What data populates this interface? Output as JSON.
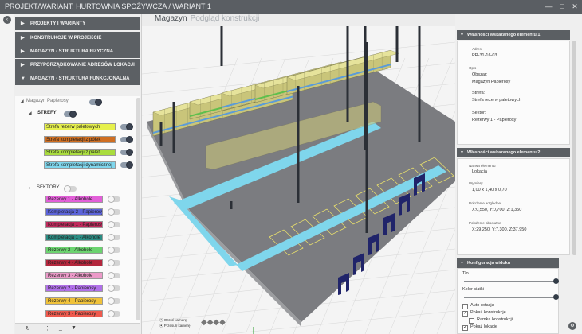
{
  "titlebar": {
    "title": "PROJEKT/WARIANT: HURTOWNIA SPOŻYWCZA / WARIANT 1"
  },
  "left": {
    "sections": [
      {
        "label": "Projekty i warianty"
      },
      {
        "label": "Konstrukcje w projekcie"
      },
      {
        "label": "Magazyn - struktura fizyczna"
      },
      {
        "label": "Przyporządkowanie adresów lokacji"
      },
      {
        "label": "Magazyn - struktura funkcjonalna"
      }
    ],
    "tree": {
      "root": "Magazyn Papierosy",
      "strefy_label": "STREFY",
      "strefy": [
        {
          "label": "Strefa rezerw paletowych",
          "color": "#e6f04c",
          "on": true
        },
        {
          "label": "Strefa kompletacji z półek",
          "color": "#cf6e22",
          "on": true
        },
        {
          "label": "Strefa kompletacji z palet",
          "color": "#a9dc3e",
          "on": true
        },
        {
          "label": "Strefa kompletacji dynamicznej",
          "color": "#7fd6ec",
          "on": true
        }
      ],
      "sektory_label": "SEKTORY",
      "sektory": [
        {
          "label": "Rezerwy 1 - Alkohole",
          "color": "#e25fd8",
          "on": false
        },
        {
          "label": "Kompletacja 2 - Papierosy",
          "color": "#5b63d9",
          "on": false
        },
        {
          "label": "Kompletacja 1 - Papierosy",
          "color": "#c0295c",
          "on": false
        },
        {
          "label": "Kompletacja 1 - Alkohole",
          "color": "#2a8c83",
          "on": false
        },
        {
          "label": "Rezerwy 2 - Alkohole",
          "color": "#6bd36f",
          "on": false
        },
        {
          "label": "Rezerwy 4 - Alkohole",
          "color": "#b3263c",
          "on": false
        },
        {
          "label": "Rezerwy 3 - Alkohole",
          "color": "#ec9ac9",
          "on": false
        },
        {
          "label": "Rezerwy 2 - Papierosy",
          "color": "#b070e8",
          "on": false
        },
        {
          "label": "Rezerwy 4 - Papierosy",
          "color": "#f0c23a",
          "on": false
        },
        {
          "label": "Rezerwy 3 - Papierosy",
          "color": "#ef5a4e",
          "on": false
        }
      ]
    },
    "bottom_tools": [
      "refresh-icon",
      "more-icon",
      "underscore-icon",
      "filter-icon",
      "more-icon"
    ]
  },
  "main": {
    "title": "Magazyn",
    "subtitle": "Podgląd konstrukcji",
    "camera": {
      "rotate_label": "Obróć kamerę",
      "move_label": "Przesuń kamerę"
    },
    "colors": {
      "floor": "#7b7c80",
      "rack_top": "#e6e39b",
      "rack_side": "#c9c57a",
      "aisle": "#7fd6ec",
      "dock": "#20246a",
      "column": "#2b2f36"
    }
  },
  "right": {
    "panel1": {
      "title": "Własności wskazanego elementu 1",
      "adres_label": "Adres",
      "adres_value": "PR-31-16-03",
      "opis_label": "Opis",
      "obszar_label": "Obszar:",
      "obszar_value": "Magazyn Papierosy",
      "strefa_label": "Strefa:",
      "strefa_value": "Strefa rezerw paletowych",
      "sektor_label": "Sektor:",
      "sektor_value": "Rezerwy 1 - Papierosy"
    },
    "panel2": {
      "title": "Własności wskazanego elementu 2",
      "nazwa_label": "Nazwa elementu",
      "nazwa_value": "Lokacja",
      "wymiary_label": "Wymiary",
      "wymiary_value": "1,00 x 1,40 x 0,70",
      "wzgl_label": "Położenie względne",
      "wzgl_value": "X:0,550, Y:0,700, Z:1,350",
      "abs_label": "Położenie absolutne",
      "abs_value": "X:29,250, Y:7,300, Z:37,950"
    },
    "panel3": {
      "title": "Konfiguracja widoku",
      "tlo_label": "Tło",
      "tlo_level": 1.0,
      "siatka_label": "Kolor siatki",
      "siatka_level": 1.0,
      "checks": [
        {
          "label": "Auto-rotacja",
          "checked": false
        },
        {
          "label": "Pokaż konstrukcje",
          "checked": true
        },
        {
          "label": "Ramka konstrukcji",
          "checked": false
        },
        {
          "label": "Pokaż lokacje",
          "checked": true
        }
      ]
    }
  }
}
